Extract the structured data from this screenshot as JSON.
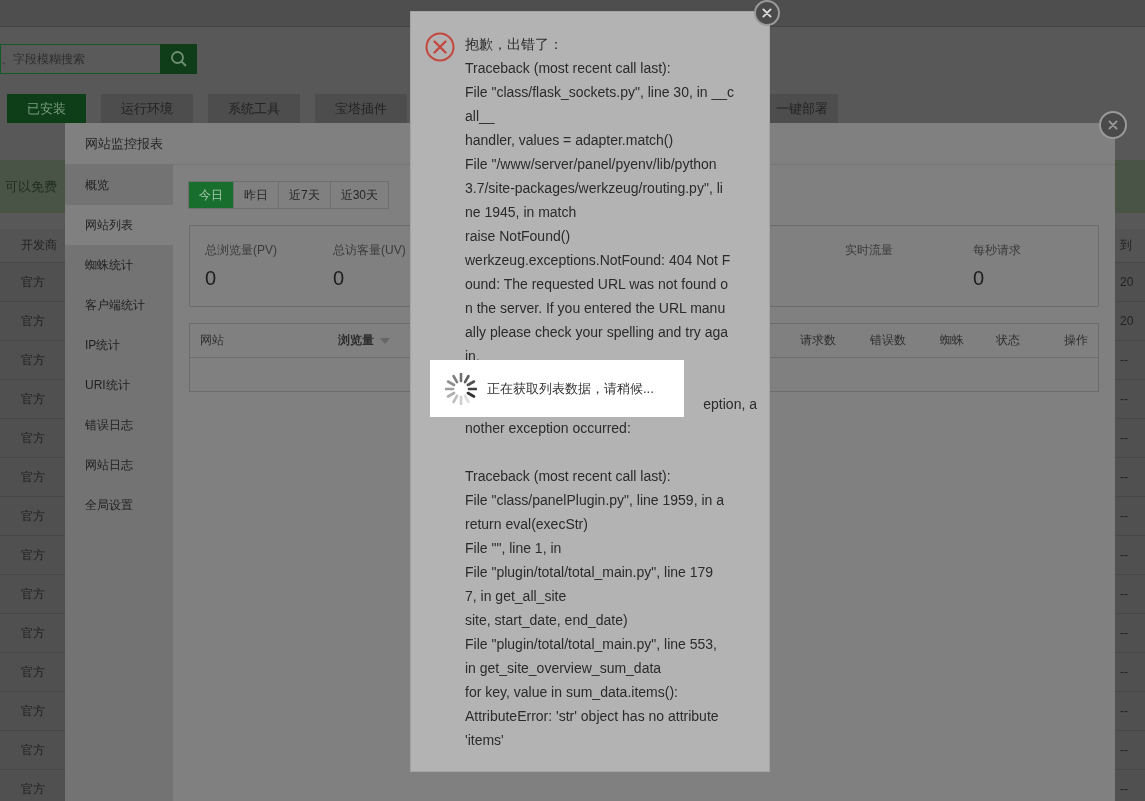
{
  "page": {
    "search": {
      "placeholder": "、字段模糊搜索"
    },
    "tabs": [
      {
        "label": "已安装",
        "selected": true
      },
      {
        "label": "运行环境",
        "selected": false
      },
      {
        "label": "系统工具",
        "selected": false
      },
      {
        "label": "宝塔插件",
        "selected": false
      },
      {
        "label": "一键部署",
        "selected": false
      }
    ],
    "notice": "可以免费",
    "table": {
      "columns": [
        "开发商",
        "到"
      ],
      "rows": [
        [
          "官方",
          "20"
        ],
        [
          "官方",
          "20"
        ],
        [
          "官方",
          "--"
        ],
        [
          "官方",
          "--"
        ],
        [
          "官方",
          "--"
        ],
        [
          "官方",
          "--"
        ],
        [
          "官方",
          "--"
        ],
        [
          "官方",
          "--"
        ],
        [
          "官方",
          "--"
        ],
        [
          "官方",
          "--"
        ],
        [
          "官方",
          "--"
        ],
        [
          "官方",
          "--"
        ],
        [
          "官方",
          "--"
        ],
        [
          "官方",
          "--"
        ]
      ]
    }
  },
  "monitor_dialog": {
    "title": "网站监控报表",
    "sidebar": [
      {
        "label": "概览",
        "selected": false
      },
      {
        "label": "网站列表",
        "selected": true
      },
      {
        "label": "蜘蛛统计",
        "selected": false
      },
      {
        "label": "客户端统计",
        "selected": false
      },
      {
        "label": "IP统计",
        "selected": false
      },
      {
        "label": "URI统计",
        "selected": false
      },
      {
        "label": "错误日志",
        "selected": false
      },
      {
        "label": "网站日志",
        "selected": false
      },
      {
        "label": "全局设置",
        "selected": false
      }
    ],
    "date_tabs": [
      {
        "label": "今日",
        "selected": true
      },
      {
        "label": "昨日",
        "selected": false
      },
      {
        "label": "近7天",
        "selected": false
      },
      {
        "label": "近30天",
        "selected": false
      }
    ],
    "stats": [
      {
        "label": "总浏览量(PV)",
        "value": "0"
      },
      {
        "label": "总访客量(UV)",
        "value": "0"
      },
      {
        "label": "实时流量"
      },
      {
        "label": "每秒请求",
        "value": "0"
      }
    ],
    "table": {
      "columns": [
        {
          "label": "网站",
          "sorted": false
        },
        {
          "label": "浏览量",
          "sorted": true
        },
        {
          "label": "请求数",
          "sorted": false
        },
        {
          "label": "错误数",
          "sorted": false
        },
        {
          "label": "蜘蛛",
          "sorted": false
        },
        {
          "label": "状态",
          "sorted": false
        },
        {
          "label": "操作",
          "sorted": false
        }
      ]
    }
  },
  "error_dialog": {
    "lines": [
      {
        "kind": "text",
        "text": "抱歉，出错了："
      },
      {
        "kind": "text",
        "text": "Traceback (most recent call last):"
      },
      {
        "kind": "text",
        "text": "File \"class/flask_sockets.py\", line 30, in __c"
      },
      {
        "kind": "text",
        "text": "all__"
      },
      {
        "kind": "text",
        "text": "handler, values = adapter.match()"
      },
      {
        "kind": "text",
        "text": "File \"/www/server/panel/pyenv/lib/python"
      },
      {
        "kind": "text",
        "text": "3.7/site-packages/werkzeug/routing.py\", li"
      },
      {
        "kind": "text",
        "text": "ne 1945, in match"
      },
      {
        "kind": "text",
        "text": "raise NotFound()"
      },
      {
        "kind": "text",
        "text": "werkzeug.exceptions.NotFound: 404 Not F"
      },
      {
        "kind": "text",
        "text": "ound: The requested URL was not found o"
      },
      {
        "kind": "text",
        "text": "n the server. If you entered the URL manu"
      },
      {
        "kind": "text",
        "text": "ally please check your spelling and try aga"
      },
      {
        "kind": "text",
        "text": "in."
      },
      {
        "kind": "blank"
      },
      {
        "kind": "cut",
        "text": "eption, a"
      },
      {
        "kind": "text",
        "text": "nother exception occurred:"
      },
      {
        "kind": "blank"
      },
      {
        "kind": "text",
        "text": "Traceback (most recent call last):"
      },
      {
        "kind": "text",
        "text": "File \"class/panelPlugin.py\", line 1959, in a"
      },
      {
        "kind": "text",
        "text": "return eval(execStr)"
      },
      {
        "kind": "text",
        "text": "File \"\", line 1, in"
      },
      {
        "kind": "text",
        "text": "File \"plugin/total/total_main.py\", line 179"
      },
      {
        "kind": "text",
        "text": "7, in get_all_site"
      },
      {
        "kind": "text",
        "text": "site, start_date, end_date)"
      },
      {
        "kind": "text",
        "text": "File \"plugin/total/total_main.py\", line 553,"
      },
      {
        "kind": "text",
        "text": "in get_site_overview_sum_data"
      },
      {
        "kind": "text",
        "text": "for key, value in sum_data.items():"
      },
      {
        "kind": "text",
        "text": "AttributeError: 'str' object has no attribute"
      },
      {
        "kind": "text",
        "text": "'items'"
      }
    ]
  },
  "loading": {
    "text": "正在获取列表数据，请稍候..."
  }
}
